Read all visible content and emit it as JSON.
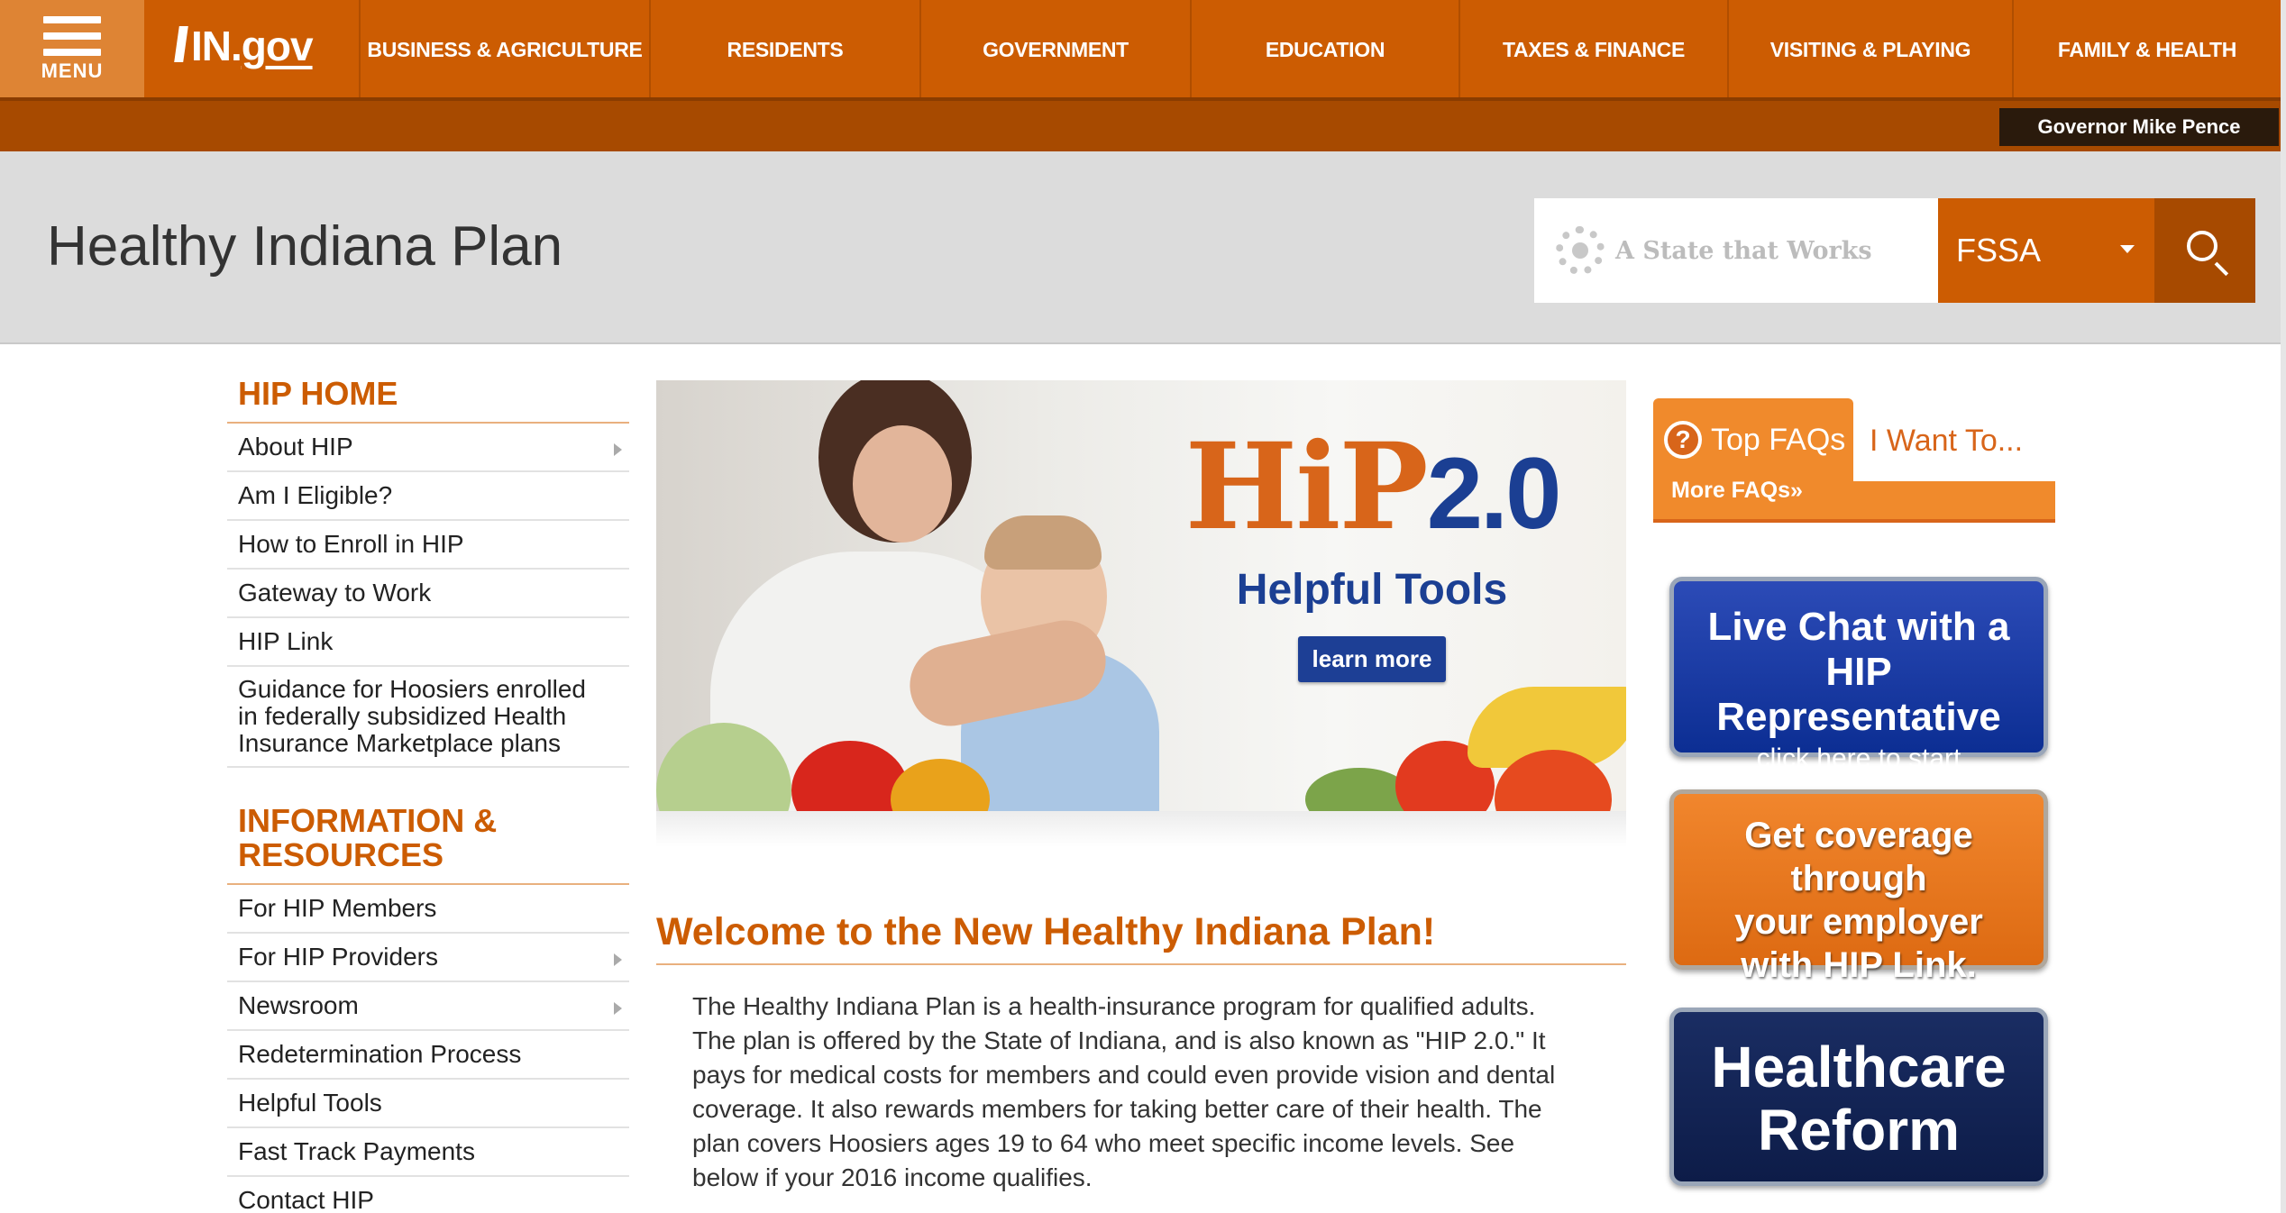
{
  "header": {
    "menu_label": "MENU",
    "logo_text": "IN.",
    "logo_gov": "gov",
    "nav": [
      "BUSINESS & AGRICULTURE",
      "RESIDENTS",
      "GOVERNMENT",
      "EDUCATION",
      "TAXES & FINANCE",
      "VISITING & PLAYING",
      "FAMILY & HEALTH"
    ],
    "governor_link": "Governor Mike Pence"
  },
  "title_band": {
    "page_title": "Healthy Indiana Plan",
    "search_placeholder": "A State that Works",
    "agency_selected": "FSSA"
  },
  "sidebar": {
    "section1_heading": "HIP HOME",
    "section1_items": [
      {
        "label": "About HIP",
        "arrow": true
      },
      {
        "label": "Am I Eligible?",
        "arrow": false
      },
      {
        "label": "How to Enroll in HIP",
        "arrow": false
      },
      {
        "label": "Gateway to Work",
        "arrow": false
      },
      {
        "label": "HIP Link",
        "arrow": false
      },
      {
        "label": "Guidance for Hoosiers enrolled in federally subsidized Health Insurance Marketplace plans",
        "arrow": false
      }
    ],
    "section2_heading": "INFORMATION & RESOURCES",
    "section2_items": [
      {
        "label": "For HIP Members",
        "arrow": false
      },
      {
        "label": "For HIP Providers",
        "arrow": true
      },
      {
        "label": "Newsroom",
        "arrow": true
      },
      {
        "label": "Redetermination Process",
        "arrow": false
      },
      {
        "label": "Helpful Tools",
        "arrow": false
      },
      {
        "label": "Fast Track Payments",
        "arrow": false
      },
      {
        "label": "Contact HIP",
        "arrow": false
      }
    ]
  },
  "hero": {
    "logo_hip": "HiP",
    "logo_version": "2.0",
    "subtitle": "Helpful Tools",
    "button": "learn more"
  },
  "main": {
    "welcome_title": "Welcome to the New Healthy Indiana Plan!",
    "welcome_body": "The Healthy Indiana Plan is a health-insurance program for qualified adults. The plan is offered by the State of Indiana, and is also known as \"HIP 2.0.\" It pays for medical costs for members and could even provide vision and dental coverage. It also rewards members for taking better care of their health. The plan covers Hoosiers ages 19 to 64 who meet specific income levels. See below if your 2016 income qualifies."
  },
  "right": {
    "faq_icon": "?",
    "tab_faqs": "Top FAQs",
    "tab_want": "I Want To...",
    "more_faqs": "More FAQs»",
    "promo_chat_l1": "Live Chat with a HIP",
    "promo_chat_l2": "Representative",
    "promo_chat_l3": "click here to start",
    "promo_link_l1": "Get coverage through",
    "promo_link_l2": "your employer",
    "promo_link_l3": "with HIP Link.",
    "promo_reform_l1": "Healthcare",
    "promo_reform_l2": "Reform"
  },
  "colors": {
    "brand_orange": "#cc5c02",
    "dark_orange": "#a74a00",
    "hip_blue": "#1b3f93"
  }
}
